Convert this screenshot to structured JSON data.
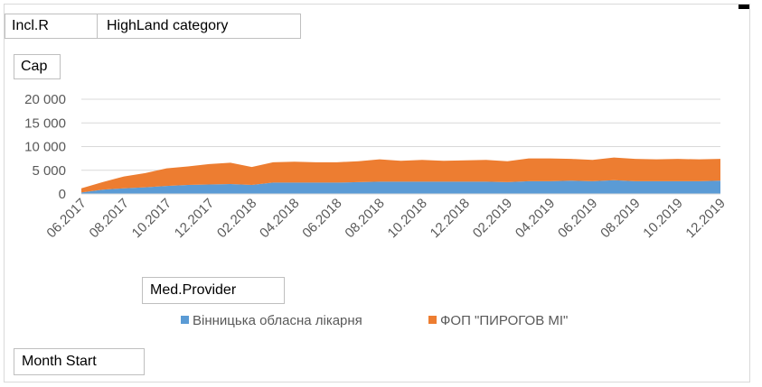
{
  "pivot_fields": {
    "filters": [
      "Incl.R",
      "HighLand category"
    ],
    "values": "Cap",
    "legend": "Med.Provider",
    "axis": "Month Start"
  },
  "chart_data": {
    "type": "area",
    "stacked": true,
    "title": "",
    "xlabel": "",
    "ylabel": "",
    "ylim": [
      0,
      20000
    ],
    "yticks": [
      0,
      5000,
      10000,
      15000,
      20000
    ],
    "ytick_labels": [
      "0",
      "5 000",
      "10 000",
      "15 000",
      "20 000"
    ],
    "grid": "horizontal",
    "legend_position": "bottom",
    "categories": [
      "06.2017",
      "07.2017",
      "08.2017",
      "09.2017",
      "10.2017",
      "11.2017",
      "12.2017",
      "01.2018",
      "02.2018",
      "03.2018",
      "04.2018",
      "05.2018",
      "06.2018",
      "07.2018",
      "08.2018",
      "09.2018",
      "10.2018",
      "11.2018",
      "12.2018",
      "01.2019",
      "02.2019",
      "03.2019",
      "04.2019",
      "05.2019",
      "06.2019",
      "07.2019",
      "08.2019",
      "09.2019",
      "10.2019",
      "11.2019",
      "12.2019"
    ],
    "xtick_labels": [
      "06.2017",
      "08.2017",
      "10.2017",
      "12.2017",
      "02.2018",
      "04.2018",
      "06.2018",
      "08.2018",
      "10.2018",
      "12.2018",
      "02.2019",
      "04.2019",
      "06.2019",
      "08.2019",
      "10.2019",
      "12.2019"
    ],
    "series": [
      {
        "name": "Вінницька обласна лікарня",
        "color": "#5b9bd5",
        "values": [
          300,
          900,
          1200,
          1400,
          1700,
          1900,
          2000,
          2100,
          1900,
          2400,
          2400,
          2400,
          2400,
          2500,
          2600,
          2600,
          2600,
          2600,
          2600,
          2600,
          2500,
          2700,
          2700,
          2800,
          2700,
          2900,
          2700,
          2700,
          2700,
          2700,
          2800
        ]
      },
      {
        "name": "ФОП \"ПИРОГОВ МІ\"",
        "color": "#ed7d31",
        "values": [
          900,
          1600,
          2500,
          3000,
          3700,
          3900,
          4300,
          4500,
          3800,
          4300,
          4400,
          4300,
          4300,
          4400,
          4700,
          4400,
          4600,
          4400,
          4500,
          4600,
          4400,
          4800,
          4800,
          4600,
          4500,
          4800,
          4700,
          4600,
          4700,
          4600,
          4600
        ]
      }
    ]
  }
}
